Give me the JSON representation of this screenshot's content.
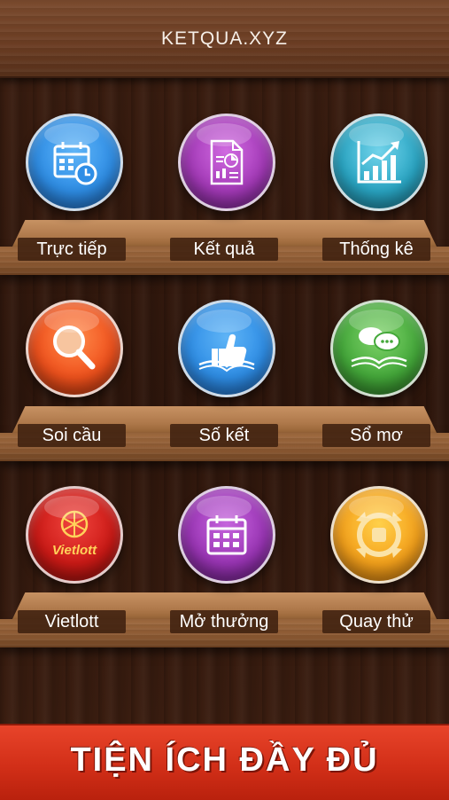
{
  "header": {
    "title": "KETQUA.XYZ"
  },
  "tiles": [
    {
      "label": "Trực tiếp",
      "icon": "calendar-clock-icon",
      "color": "#2f8ee6"
    },
    {
      "label": "Kết quả",
      "icon": "document-report-icon",
      "color": "#a43ab8"
    },
    {
      "label": "Thống kê",
      "icon": "chart-growth-icon",
      "color": "#2aa6c4"
    },
    {
      "label": "Soi cầu",
      "icon": "magnifier-icon",
      "color": "#f0521d"
    },
    {
      "label": "Số kết",
      "icon": "thumbs-up-book-icon",
      "color": "#2f8ee6"
    },
    {
      "label": "Sổ mơ",
      "icon": "chat-book-icon",
      "color": "#44a83a"
    },
    {
      "label": "Vietlott",
      "icon": "vietlott-logo-icon",
      "color": "#cc1a16",
      "logo_text": "Vietlott"
    },
    {
      "label": "Mở thưởng",
      "icon": "calendar-grid-icon",
      "color": "#9a35b5"
    },
    {
      "label": "Quay thử",
      "icon": "rotate-arrows-icon",
      "color": "#f5a21c"
    }
  ],
  "footer": {
    "banner": "TIỆN ÍCH ĐẦY ĐỦ"
  }
}
